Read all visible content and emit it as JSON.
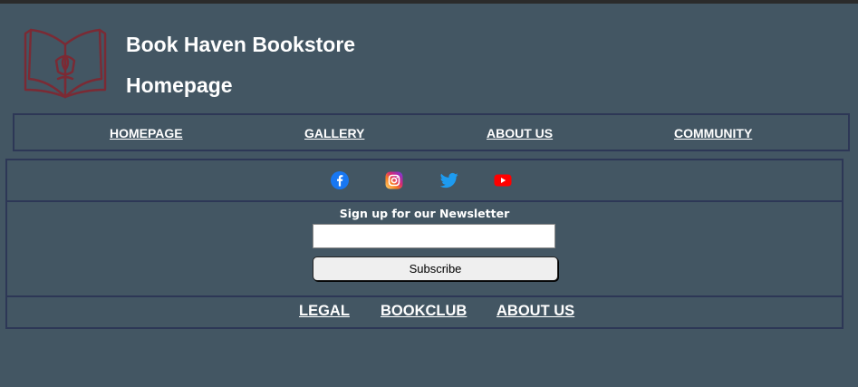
{
  "header": {
    "title_line1": "Book Haven Bookstore",
    "title_line2": "Homepage",
    "logo_icon": "open-book-tulip-logo",
    "logo_color": "#7b2a34"
  },
  "nav": {
    "items": [
      {
        "label": "HOMEPAGE"
      },
      {
        "label": "GALLERY"
      },
      {
        "label": "ABOUT US"
      },
      {
        "label": "COMMUNITY"
      }
    ]
  },
  "social": {
    "icons": [
      "facebook-icon",
      "instagram-icon",
      "twitter-icon",
      "youtube-icon"
    ],
    "colors": {
      "facebook": "#1877f2",
      "instagram": "#dd2a7b",
      "twitter": "#1d9bf0",
      "youtube": "#ff0000"
    }
  },
  "newsletter": {
    "heading": "Sign up for our Newsletter",
    "input_value": "",
    "button_label": "Subscribe"
  },
  "footer": {
    "links": [
      {
        "label": "LEGAL"
      },
      {
        "label": "BOOKCLUB"
      },
      {
        "label": "ABOUT US"
      }
    ]
  },
  "colors": {
    "background": "#435663",
    "border": "#2d3756",
    "text": "#ffffff"
  }
}
